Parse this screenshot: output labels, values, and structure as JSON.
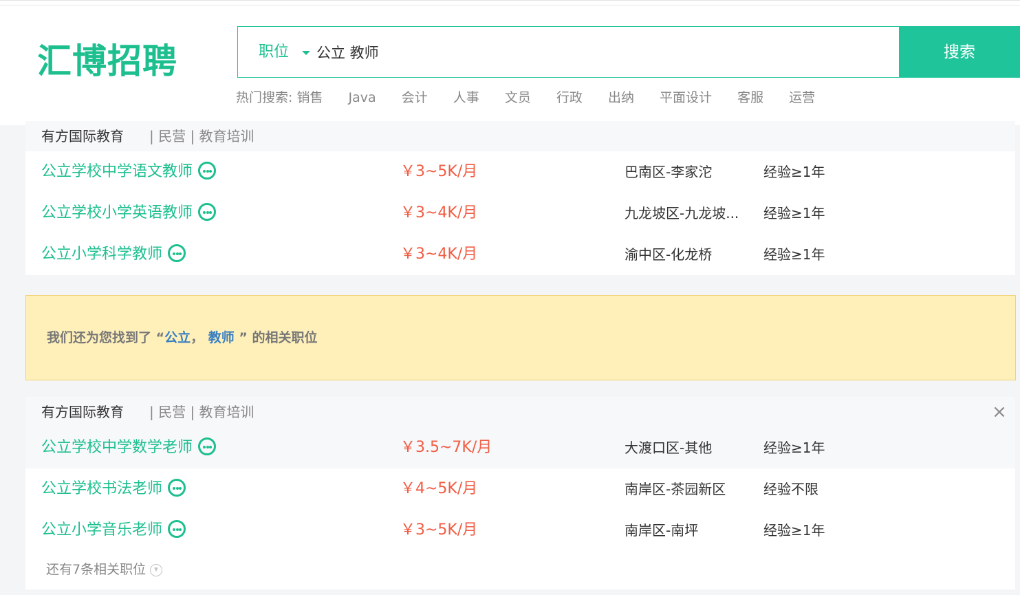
{
  "header": {
    "logo": "汇博招聘",
    "search": {
      "category": "职位",
      "query": "公立 教师",
      "button": "搜索"
    },
    "hot_label": "热门搜索:",
    "hot_items": [
      "销售",
      "Java",
      "会计",
      "人事",
      "文员",
      "行政",
      "出纳",
      "平面设计",
      "客服",
      "运营"
    ]
  },
  "cards": [
    {
      "company": "有方国际教育",
      "meta": "| 民营 | 教育培训",
      "jobs": [
        {
          "title": "公立学校中学语文教师",
          "salary": "￥3~5K/月",
          "location": "巴南区-李家沱",
          "experience": "经验≥1年"
        },
        {
          "title": "公立学校小学英语教师",
          "salary": "￥3~4K/月",
          "location": "九龙坡区-九龙坡...",
          "experience": "经验≥1年"
        },
        {
          "title": "公立小学科学教师",
          "salary": "￥3~4K/月",
          "location": "渝中区-化龙桥",
          "experience": "经验≥1年"
        }
      ]
    },
    {
      "company": "有方国际教育",
      "meta": "| 民营 | 教育培训",
      "jobs": [
        {
          "title": "公立学校中学数学老师",
          "salary": "￥3.5~7K/月",
          "location": "大渡口区-其他",
          "experience": "经验≥1年"
        },
        {
          "title": "公立学校书法老师",
          "salary": "￥4~5K/月",
          "location": "南岸区-茶园新区",
          "experience": "经验不限"
        },
        {
          "title": "公立小学音乐老师",
          "salary": "￥3~5K/月",
          "location": "南岸区-南坪",
          "experience": "经验≥1年"
        }
      ],
      "more": "还有7条相关职位"
    }
  ],
  "notice": {
    "prefix": "我们还为您找到了 “",
    "kw1": "公立",
    "sep": "，",
    "kw2": "教师",
    "suffix": "” 的相关职位"
  },
  "colors": {
    "brand": "#1dbf8f",
    "salary": "#f15d44",
    "keyword": "#3a7fc1",
    "notice_bg": "#fff0ba"
  },
  "icons": {
    "chat": "chat-bubble-icon",
    "close": "close-icon",
    "expand": "arrow-down-circle-icon",
    "dropdown": "caret-down-icon"
  }
}
